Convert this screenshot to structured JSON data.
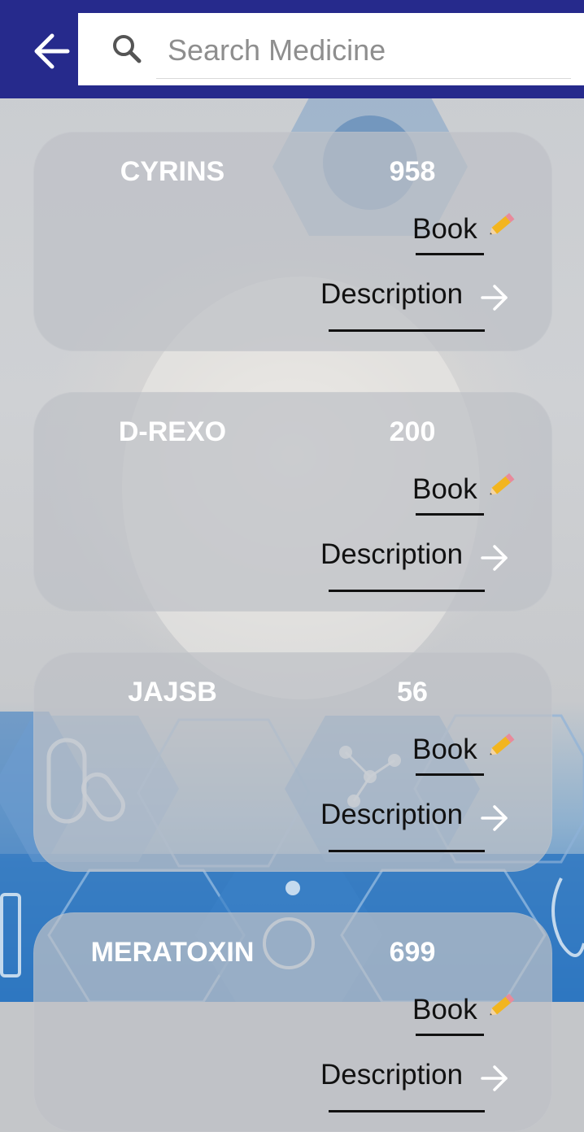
{
  "header": {
    "back_icon": "arrow-left-icon",
    "search": {
      "icon": "search-icon",
      "placeholder": "Search Medicine",
      "value": ""
    }
  },
  "colors": {
    "header_bg": "#262a8c",
    "card_bg": "rgba(190,192,198,0.72)",
    "card_title_text": "#ffffff",
    "link_text": "#111111"
  },
  "medicines": [
    {
      "name": "CYRINS",
      "price": "958",
      "book_label": "Book",
      "book_icon": "pencil-icon",
      "description_label": "Description",
      "description_icon": "arrow-right-icon"
    },
    {
      "name": "D-REXO",
      "price": "200",
      "book_label": "Book",
      "book_icon": "pencil-icon",
      "description_label": "Description",
      "description_icon": "arrow-right-icon"
    },
    {
      "name": "JAJSB",
      "price": "56",
      "book_label": "Book",
      "book_icon": "pencil-icon",
      "description_label": "Description",
      "description_icon": "arrow-right-icon"
    },
    {
      "name": "MERATOXIN",
      "price": "699",
      "book_label": "Book",
      "book_icon": "pencil-icon",
      "description_label": "Description",
      "description_icon": "arrow-right-icon"
    }
  ]
}
